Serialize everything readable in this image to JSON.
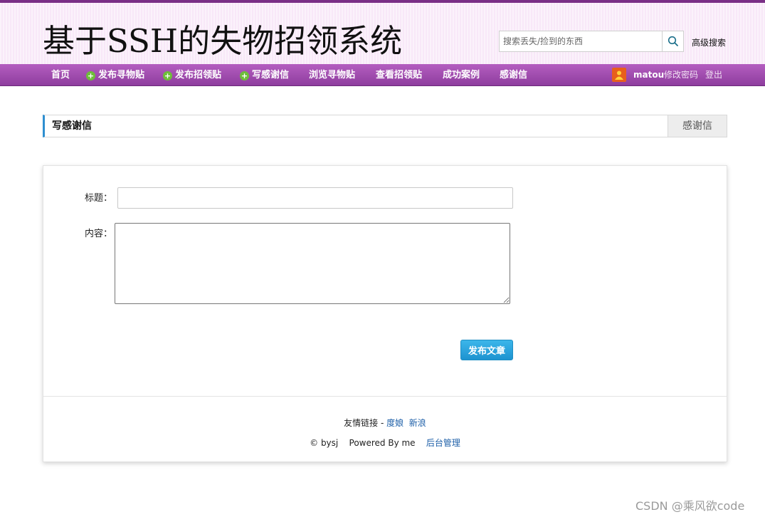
{
  "header": {
    "site_title": "基于SSH的失物招领系统",
    "search_placeholder": "搜索丢失/捡到的东西",
    "advanced_search": "高级搜索"
  },
  "nav": {
    "items": [
      {
        "label": "首页"
      },
      {
        "label": "发布寻物贴",
        "icon": "plus-icon"
      },
      {
        "label": "发布招领贴",
        "icon": "plus-icon"
      },
      {
        "label": "写感谢信",
        "icon": "plus-icon"
      },
      {
        "label": "浏览寻物贴"
      },
      {
        "label": "查看招领贴"
      },
      {
        "label": "成功案例"
      },
      {
        "label": "感谢信"
      }
    ],
    "user": {
      "name": "matou",
      "change_password": "修改密码",
      "logout": "登出"
    }
  },
  "section": {
    "title": "写感谢信",
    "tab_label": "感谢信"
  },
  "form": {
    "title_label": "标题：",
    "title_value": "",
    "content_label": "内容：",
    "content_value": "",
    "submit_label": "发布文章"
  },
  "footer": {
    "links_label": "友情链接 - ",
    "links": [
      "度娘",
      "新浪"
    ],
    "copyright": "© bysj",
    "powered": "Powered By me",
    "admin_link": "后台管理"
  },
  "watermark": "CSDN @乘风欲code",
  "colors": {
    "nav_bg": "#9a45aa",
    "header_bg": "#f8e8f8",
    "accent_blue": "#2e8fd0",
    "button_blue": "#1d93d0",
    "plus_green": "#6ebd3a"
  }
}
